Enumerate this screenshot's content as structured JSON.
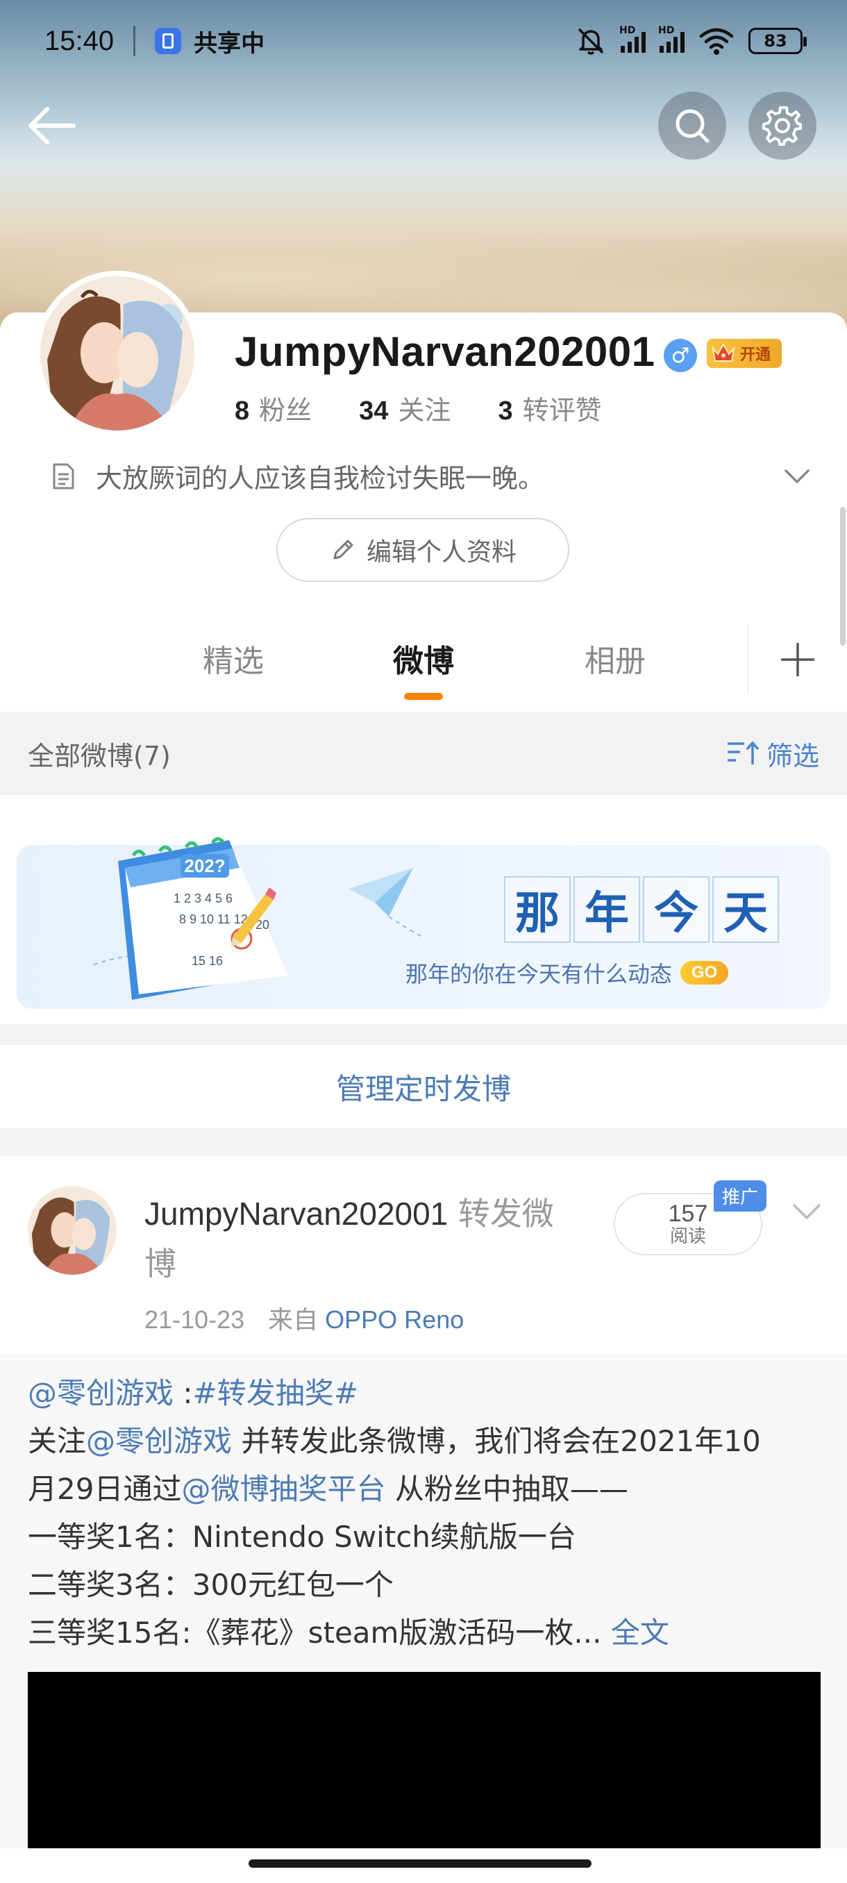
{
  "status_bar": {
    "time": "15:40",
    "share_label": "共享中",
    "signal_label": "HD",
    "battery": "83"
  },
  "header": {
    "back_icon": "back-arrow-icon",
    "search_icon": "search-icon",
    "settings_icon": "gear-icon"
  },
  "profile": {
    "username": "JumpyNarvan202001",
    "gender": "♂",
    "vip_label": "开通",
    "stats": [
      {
        "num": "8",
        "label": "粉丝"
      },
      {
        "num": "34",
        "label": "关注"
      },
      {
        "num": "3",
        "label": "转评赞"
      }
    ],
    "bio": "大放厥词的人应该自我检讨失眠一晚。",
    "edit_label": "编辑个人资料"
  },
  "tabs": [
    {
      "label": "精选",
      "active": false
    },
    {
      "label": "微博",
      "active": true
    },
    {
      "label": "相册",
      "active": false
    }
  ],
  "filter": {
    "title": "全部微博(7)",
    "button": "筛选"
  },
  "memory": {
    "title_chars": [
      "那",
      "年",
      "今",
      "天"
    ],
    "subtitle": "那年的你在今天有什么动态",
    "go": "GO",
    "calendar_year": "202?",
    "calendar_rows": [
      "1 2 3 4 5 6",
      "8 9 10 11 12",
      "15 16",
      "20"
    ]
  },
  "schedule_label": "管理定时发博",
  "post": {
    "author": "JumpyNarvan202001",
    "action": " 转发微博",
    "date": "21-10-23",
    "source_prefix": "来自 ",
    "source": "OPPO Reno",
    "reads": "157",
    "reads_label": "阅读",
    "promo": "推广",
    "lines": [
      {
        "a": "@零创游戏",
        "b": " :",
        "c": "#转发抽奖#",
        "d": ""
      },
      {
        "a": "关注",
        "b": "@零创游戏",
        "c": " 并转发此条微博，我们将会在2021年10",
        "d": ""
      },
      {
        "a": "月29日通过",
        "b": "@微博抽奖平台",
        "c": " 从粉丝中抽取——",
        "d": ""
      },
      {
        "a": "一等奖1名：Nintendo Switch续航版一台",
        "b": "",
        "c": "",
        "d": ""
      },
      {
        "a": "二等奖3名：300元红包一个",
        "b": "",
        "c": "",
        "d": ""
      },
      {
        "a": "三等奖15名:《葬花》steam版激活码一枚...",
        "b": " 全文",
        "c": "",
        "d": ""
      }
    ]
  },
  "colors": {
    "accent_orange": "#ff8200",
    "link_blue": "#4b7bb5",
    "background_gray": "#f2f2f2"
  }
}
